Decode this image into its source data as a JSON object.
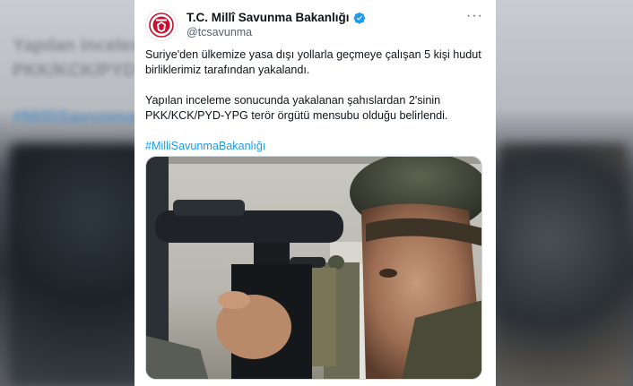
{
  "backdrop": {
    "line1": "Yapılan inceleme",
    "line2": "PKK/KCK/PYD-",
    "hashtag": "#MilliSavunmaB"
  },
  "tweet": {
    "account": {
      "display_name": "T.C. Millî Savunma Bakanlığı",
      "handle": "@tcsavunma",
      "verified": true,
      "avatar_icon": "ministry-emblem-icon"
    },
    "more_label": "···",
    "paragraphs": [
      "Suriye'den ülkemize yasa dışı yollarla geçmeye çalışan 5 kişi hudut birliklerimiz tarafından yakalandı.",
      "Yapılan inceleme sonucunda yakalanan şahıslardan 2'sinin PKK/KCK/PYD-YPG terör örgütü mensubu olduğu belirlendi."
    ],
    "hashtag": "#MilliSavunmaBakanlığı",
    "media": {
      "type": "photo",
      "subject": "soldier-with-binoculars-photo"
    }
  },
  "colors": {
    "text": "#0f1419",
    "secondary": "#536471",
    "link": "#1d9bf0",
    "verified": "#1d9bf0",
    "emblem_red": "#c8102e"
  }
}
